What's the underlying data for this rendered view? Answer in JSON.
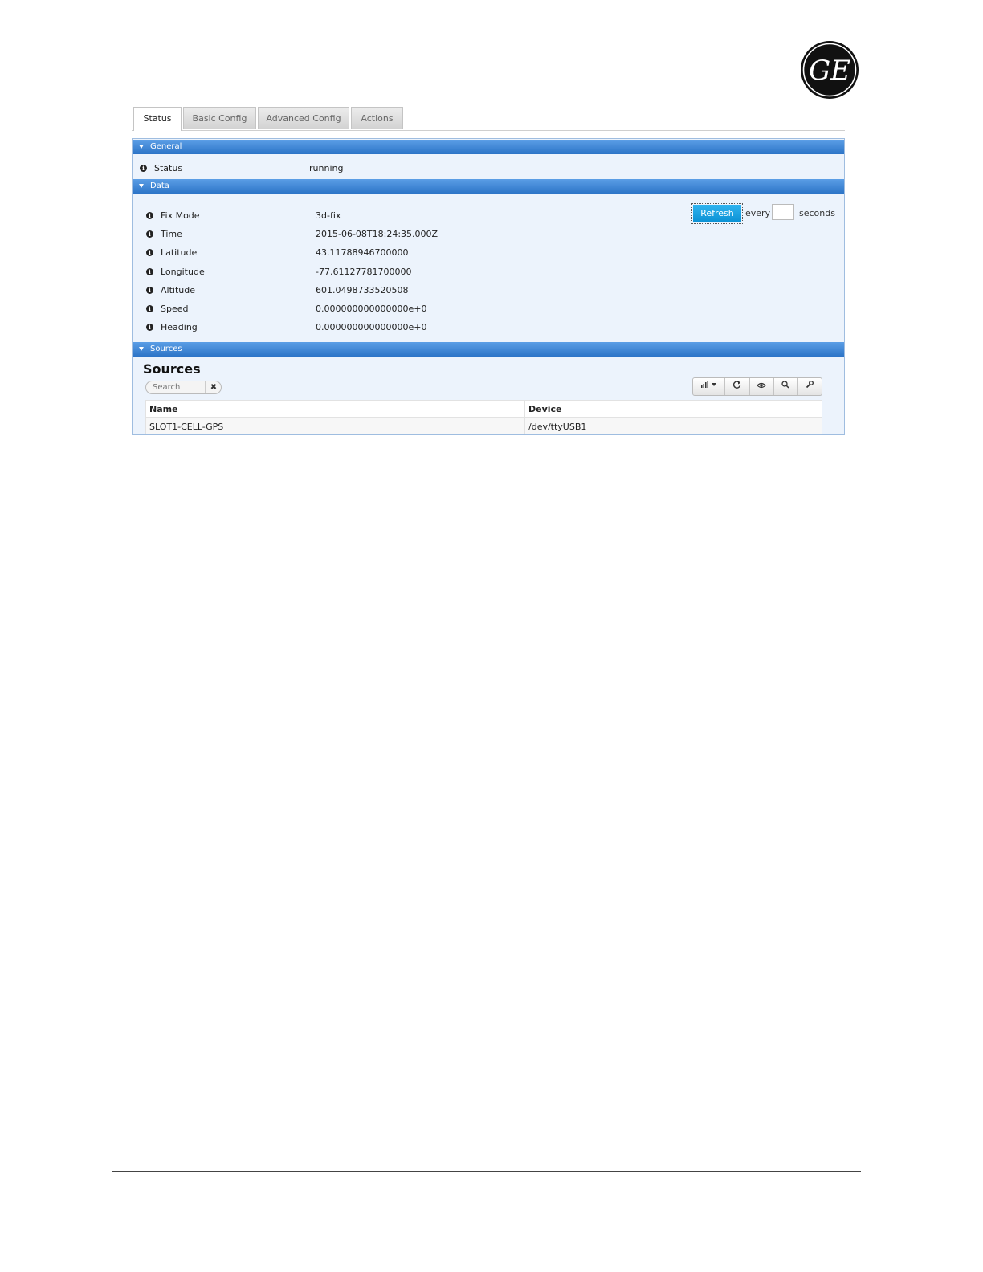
{
  "logo": {
    "name": "GE logo",
    "text": "GE"
  },
  "tabs": [
    {
      "label": "Status",
      "active": true
    },
    {
      "label": "Basic Config",
      "active": false
    },
    {
      "label": "Advanced Config",
      "active": false
    },
    {
      "label": "Actions",
      "active": false
    }
  ],
  "general": {
    "header": "General",
    "status_label": "Status",
    "status_value": "running"
  },
  "data_section": {
    "header": "Data",
    "fields": [
      {
        "label": "Fix Mode",
        "value": "3d-fix"
      },
      {
        "label": "Time",
        "value": "2015-06-08T18:24:35.000Z"
      },
      {
        "label": "Latitude",
        "value": "43.11788946700000"
      },
      {
        "label": "Longitude",
        "value": "-77.61127781700000"
      },
      {
        "label": "Altitude",
        "value": "601.0498733520508"
      },
      {
        "label": "Speed",
        "value": "0.000000000000000e+0"
      },
      {
        "label": "Heading",
        "value": "0.000000000000000e+0"
      }
    ],
    "refresh_label": "Refresh",
    "every_label": "every",
    "interval_value": "",
    "seconds_label": "seconds"
  },
  "sources": {
    "header": "Sources",
    "title": "Sources",
    "search_placeholder": "Search",
    "clear_icon": "✖",
    "toolbar": [
      "columns-icon",
      "refresh-icon",
      "eye-icon",
      "search-icon",
      "wrench-icon"
    ],
    "columns": [
      "Name",
      "Device"
    ],
    "rows": [
      [
        "SLOT1-CELL-GPS",
        "/dev/ttyUSB1"
      ]
    ]
  },
  "colors": {
    "header_blue": "#2c74c7",
    "panel_bg": "#ecf3fc",
    "refresh_button": "#0b91d4"
  }
}
